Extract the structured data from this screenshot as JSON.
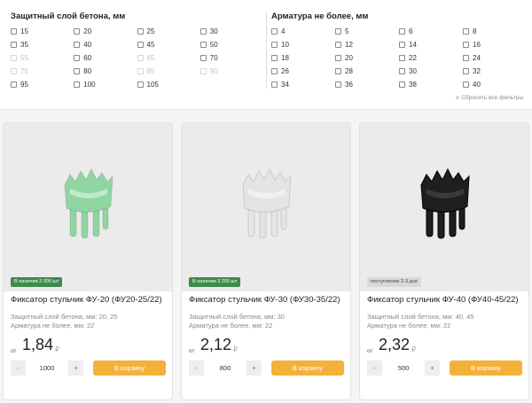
{
  "filters": {
    "concrete": {
      "title": "Защитный слой бетона, мм",
      "options": [
        {
          "label": "15",
          "disabled": false
        },
        {
          "label": "20",
          "disabled": false
        },
        {
          "label": "25",
          "disabled": false
        },
        {
          "label": "30",
          "disabled": false
        },
        {
          "label": "35",
          "disabled": false
        },
        {
          "label": "40",
          "disabled": false
        },
        {
          "label": "45",
          "disabled": false
        },
        {
          "label": "50",
          "disabled": false
        },
        {
          "label": "55",
          "disabled": true
        },
        {
          "label": "60",
          "disabled": false
        },
        {
          "label": "65",
          "disabled": true
        },
        {
          "label": "70",
          "disabled": false
        },
        {
          "label": "75",
          "disabled": true
        },
        {
          "label": "80",
          "disabled": false
        },
        {
          "label": "85",
          "disabled": true
        },
        {
          "label": "90",
          "disabled": true
        },
        {
          "label": "95",
          "disabled": false
        },
        {
          "label": "100",
          "disabled": false
        },
        {
          "label": "105",
          "disabled": false
        }
      ]
    },
    "rebar": {
      "title": "Арматура не более, мм",
      "options": [
        {
          "label": "4",
          "disabled": false
        },
        {
          "label": "5",
          "disabled": false
        },
        {
          "label": "6",
          "disabled": false
        },
        {
          "label": "8",
          "disabled": false
        },
        {
          "label": "10",
          "disabled": false
        },
        {
          "label": "12",
          "disabled": false
        },
        {
          "label": "14",
          "disabled": false
        },
        {
          "label": "16",
          "disabled": false
        },
        {
          "label": "18",
          "disabled": false
        },
        {
          "label": "20",
          "disabled": false
        },
        {
          "label": "22",
          "disabled": false
        },
        {
          "label": "24",
          "disabled": false
        },
        {
          "label": "26",
          "disabled": false
        },
        {
          "label": "28",
          "disabled": false
        },
        {
          "label": "30",
          "disabled": false
        },
        {
          "label": "32",
          "disabled": false
        },
        {
          "label": "34",
          "disabled": false
        },
        {
          "label": "36",
          "disabled": false
        },
        {
          "label": "38",
          "disabled": false
        },
        {
          "label": "40",
          "disabled": false
        }
      ]
    },
    "reset_label": "Сбросить все фильтры",
    "reset_icon": "close-icon"
  },
  "products": [
    {
      "badge": "В наличии 2 000 шт",
      "badge_style": "green",
      "name": "Фиксатор стульчик ФУ-20 (ФУ20-25/22)",
      "spec1": "Защитный слой бетона, мм: 20, 25",
      "spec2": "Арматура не более, мм: 22",
      "price_prefix": "от",
      "price": "1,84",
      "currency": "₽",
      "minus": "-",
      "plus": "+",
      "qty": "1000",
      "cart_label": "В корзину",
      "image_color": "#8fd6a2",
      "image_icon": "chair-spacer-icon"
    },
    {
      "badge": "В наличии 3 200 шт",
      "badge_style": "green",
      "name": "Фиксатор стульчик ФУ-30 (ФУ30-35/22)",
      "spec1": "Защитный слой бетона, мм: 30",
      "spec2": "Арматура не более, мм: 22",
      "price_prefix": "от",
      "price": "2,12",
      "currency": "₽",
      "minus": "-",
      "plus": "+",
      "qty": "800",
      "cart_label": "В корзину",
      "image_color": "#e4e4e4",
      "image_icon": "chair-spacer-icon"
    },
    {
      "badge": "поступление 2-3 дня",
      "badge_style": "grey",
      "name": "Фиксатор стульчик ФУ-40 (ФУ40-45/22)",
      "spec1": "Защитный слой бетона, мм: 40, 45",
      "spec2": "Арматура не более, мм: 22",
      "price_prefix": "от",
      "price": "2,32",
      "currency": "₽",
      "minus": "-",
      "plus": "+",
      "qty": "500",
      "cart_label": "В корзину",
      "image_color": "#1f1f1f",
      "image_icon": "chair-spacer-icon"
    }
  ],
  "colors": {
    "in_stock_badge": "#3f8a4c",
    "cart_button": "#f4b13a"
  }
}
